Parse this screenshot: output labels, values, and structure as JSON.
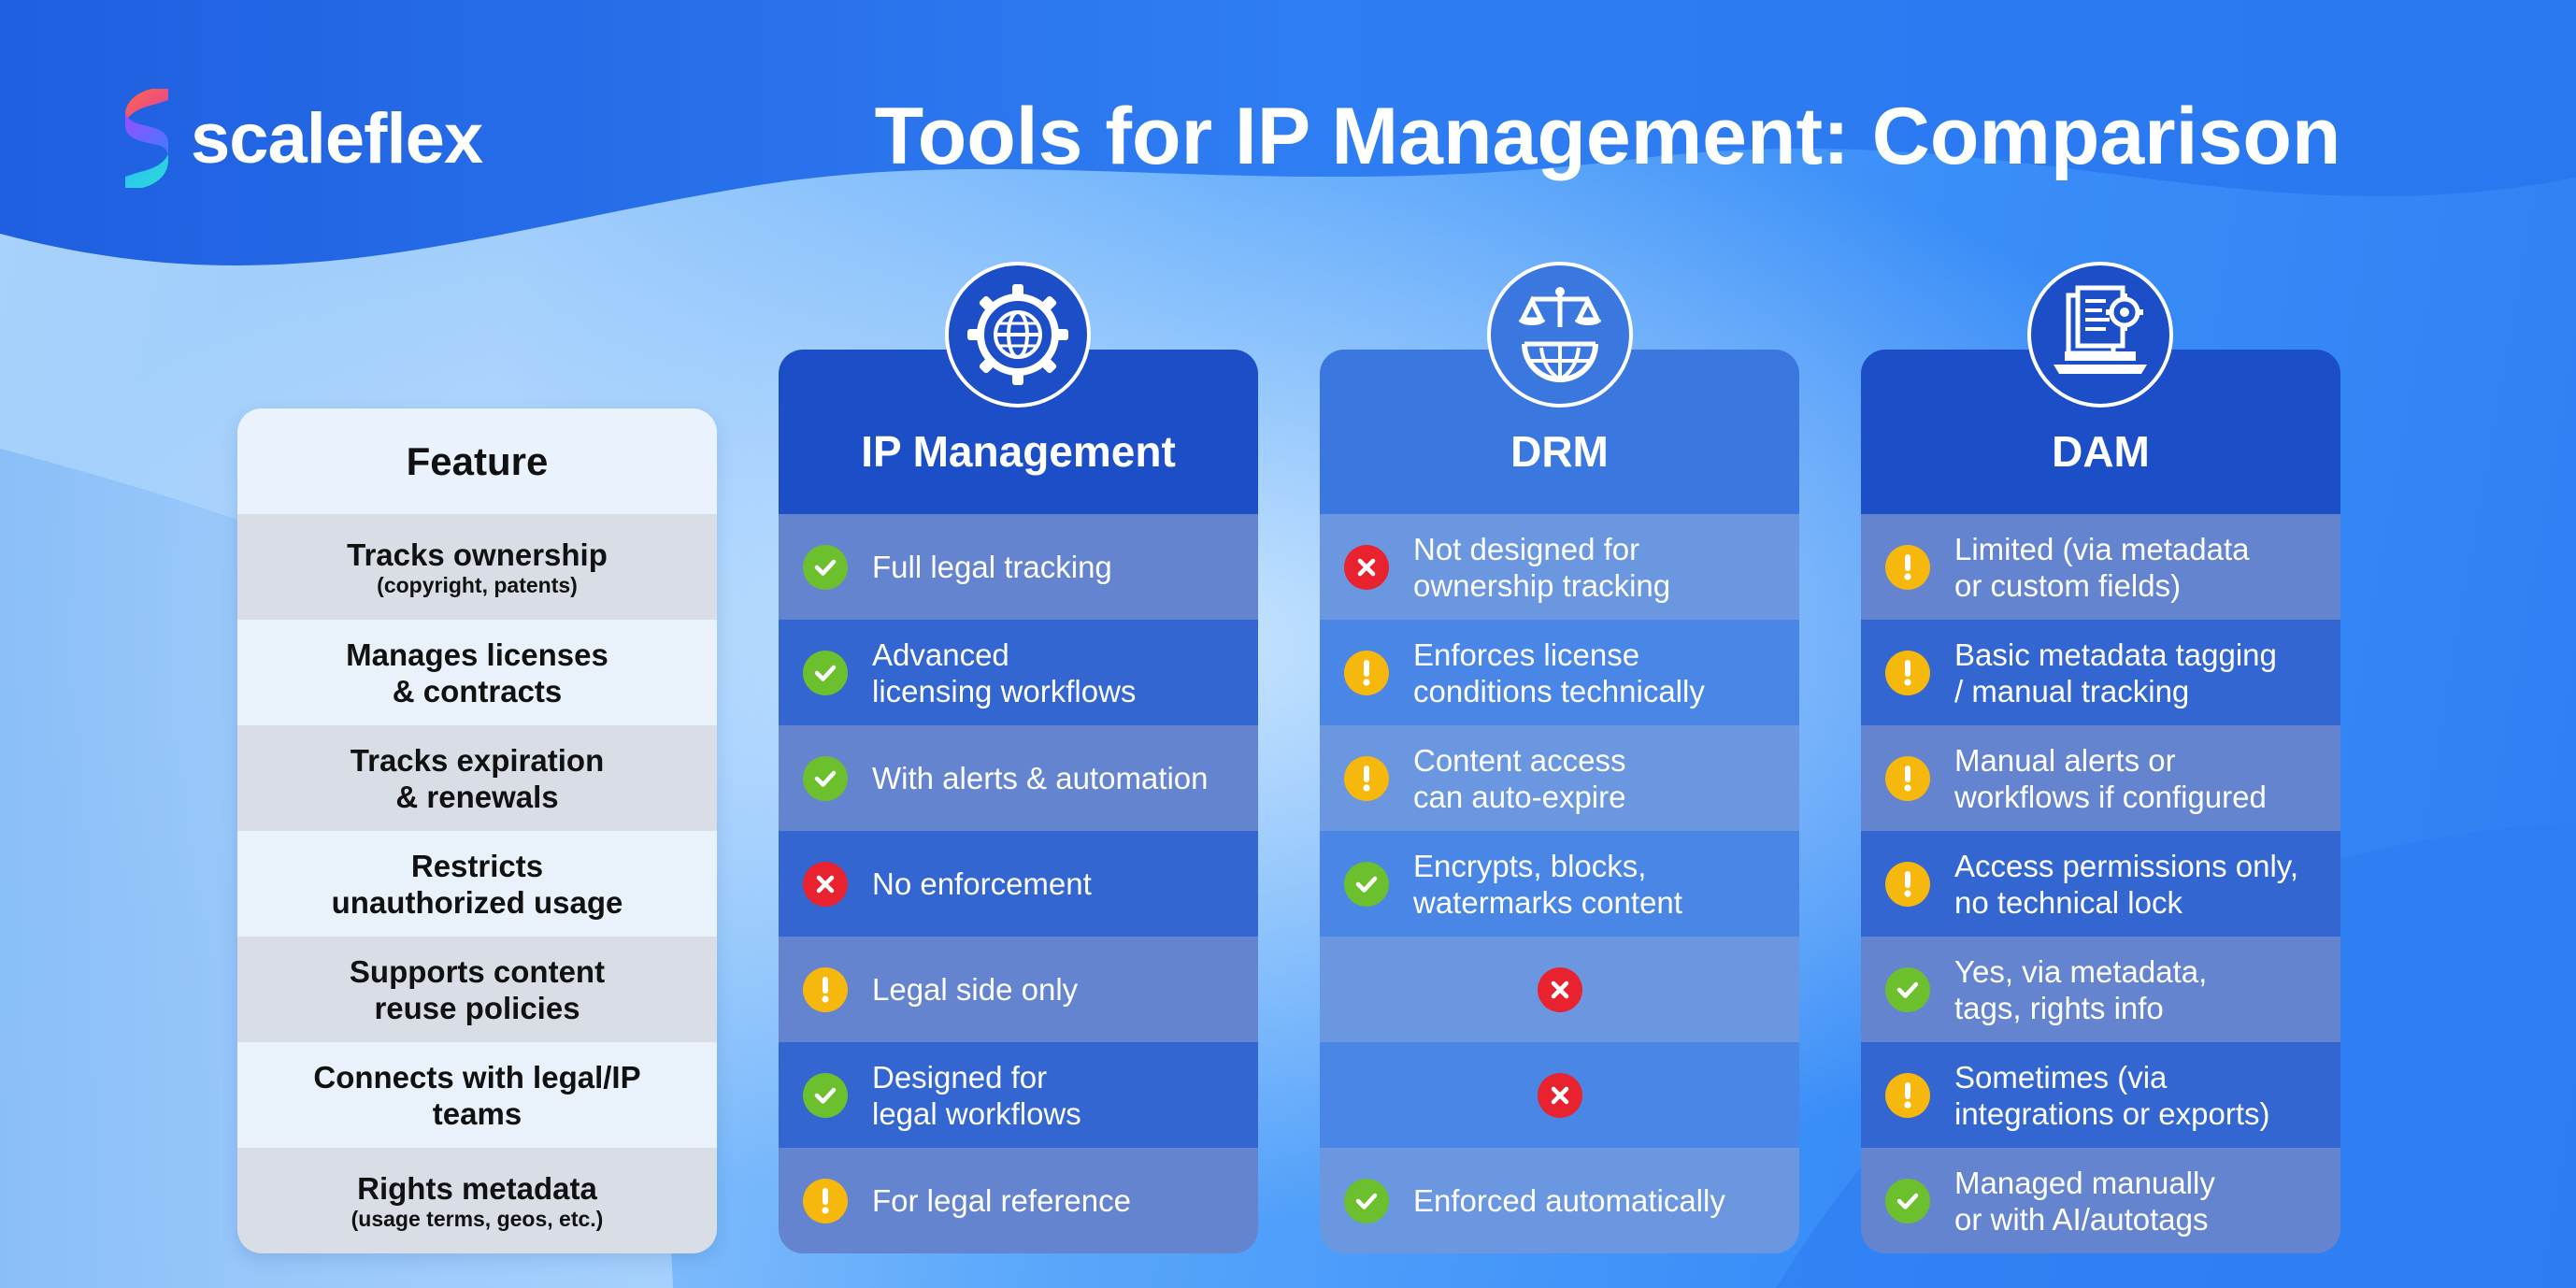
{
  "brand": {
    "name": "scaleflex"
  },
  "title": "Tools for IP Management: Comparison",
  "colors": {
    "check": "#6cbf2d",
    "warn": "#f6b80c",
    "cross": "#e8232f",
    "header_dark": "#1c4fc7",
    "header_mid": "#3a78e0"
  },
  "features": {
    "header": "Feature",
    "rows": [
      {
        "label": "Tracks ownership",
        "sub": "(copyright, patents)"
      },
      {
        "label": "Manages licenses\n& contracts",
        "sub": ""
      },
      {
        "label": "Tracks expiration\n& renewals",
        "sub": ""
      },
      {
        "label": "Restricts\nunauthorized usage",
        "sub": ""
      },
      {
        "label": "Supports content\nreuse policies",
        "sub": ""
      },
      {
        "label": "Connects with legal/IP\nteams",
        "sub": ""
      },
      {
        "label": "Rights metadata",
        "sub": "(usage terms, geos, etc.)"
      }
    ]
  },
  "tools": [
    {
      "name": "IP Management",
      "icon": "gear-globe-icon",
      "cells": [
        {
          "status": "check",
          "text": "Full legal tracking"
        },
        {
          "status": "check",
          "text": "Advanced\nlicensing workflows"
        },
        {
          "status": "check",
          "text": "With alerts & automation"
        },
        {
          "status": "cross",
          "text": "No enforcement"
        },
        {
          "status": "warn",
          "text": " Legal side only"
        },
        {
          "status": "check",
          "text": "Designed for\nlegal workflows"
        },
        {
          "status": "warn",
          "text": "For legal reference"
        }
      ]
    },
    {
      "name": "DRM",
      "icon": "scales-globe-icon",
      "cells": [
        {
          "status": "cross",
          "text": "Not designed for\nownership tracking"
        },
        {
          "status": "warn",
          "text": "Enforces license\nconditions technically"
        },
        {
          "status": "warn",
          "text": "Content access\ncan auto-expire"
        },
        {
          "status": "check",
          "text": "Encrypts, blocks,\nwatermarks content"
        },
        {
          "status": "cross",
          "text": ""
        },
        {
          "status": "cross",
          "text": ""
        },
        {
          "status": "check",
          "text": "Enforced automatically"
        }
      ]
    },
    {
      "name": "DAM",
      "icon": "laptop-documents-icon",
      "cells": [
        {
          "status": "warn",
          "text": "Limited (via metadata\nor custom fields)"
        },
        {
          "status": "warn",
          "text": "Basic metadata tagging\n/ manual tracking"
        },
        {
          "status": "warn",
          "text": "Manual alerts or\nworkflows if configured"
        },
        {
          "status": "warn",
          "text": "Access permissions only,\nno technical lock"
        },
        {
          "status": "check",
          "text": "Yes, via metadata,\ntags, rights info"
        },
        {
          "status": "warn",
          "text": "Sometimes (via\nintegrations or exports)"
        },
        {
          "status": "check",
          "text": "Managed manually\nor with AI/autotags"
        }
      ]
    }
  ]
}
